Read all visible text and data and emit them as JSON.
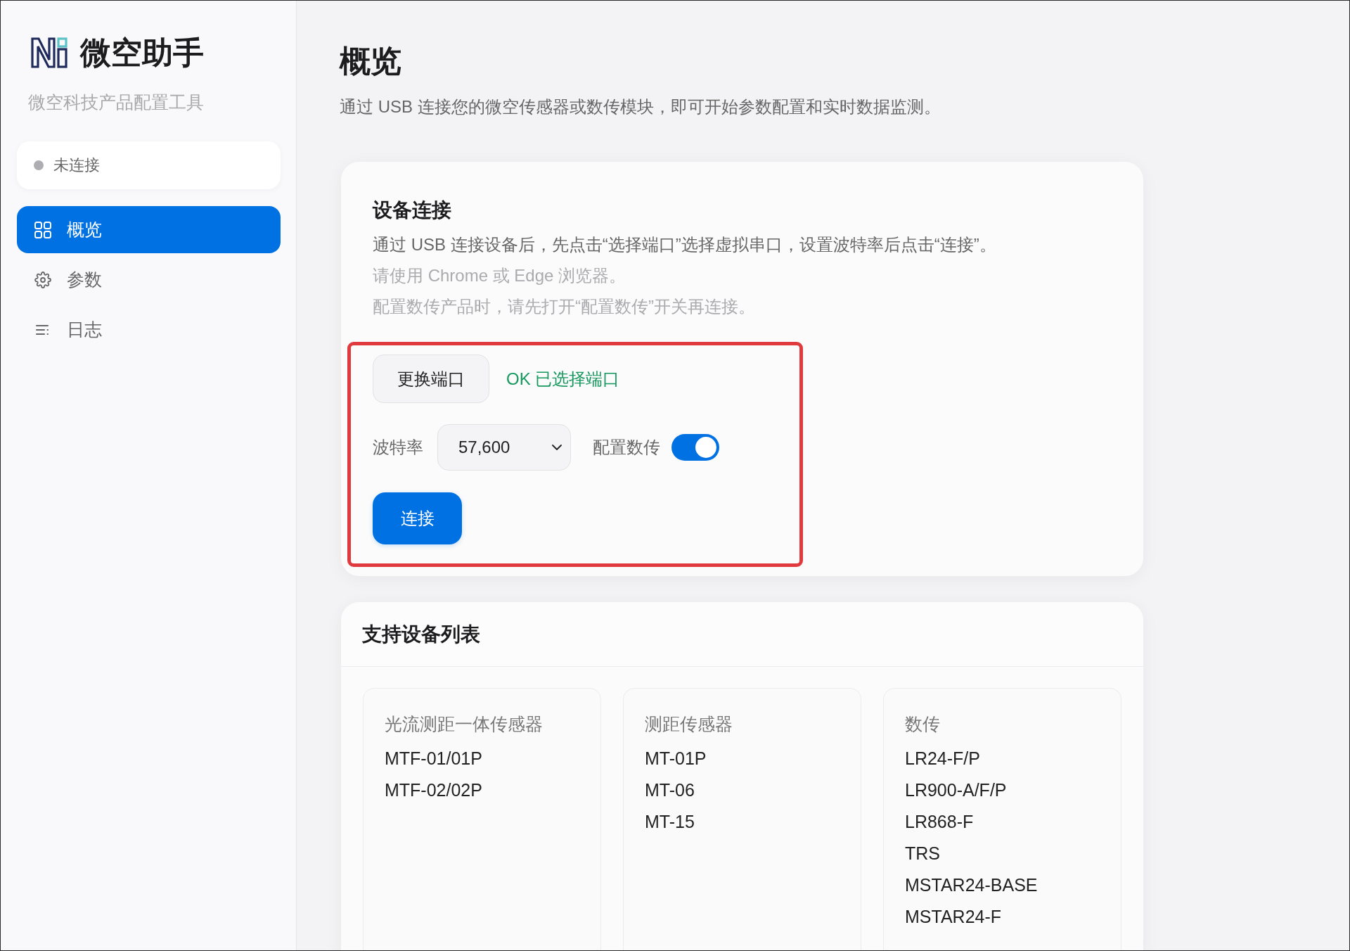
{
  "sidebar": {
    "app_name": "微空助手",
    "subtitle": "微空科技产品配置工具",
    "connection_status": {
      "label": "未连接",
      "connected": false
    },
    "nav_items": [
      {
        "label": "概览",
        "selected": true
      },
      {
        "label": "参数",
        "selected": false
      },
      {
        "label": "日志",
        "selected": false
      }
    ]
  },
  "page": {
    "title": "概览",
    "description": "通过 USB 连接您的微空传感器或数传模块，即可开始参数配置和实时数据监测。"
  },
  "connection_card": {
    "title": "设备连接",
    "instructions": [
      {
        "text": "通过 USB 连接设备后，先点击“选择端口”选择虚拟串口，设置波特率后点击“连接”。",
        "muted": false
      },
      {
        "text": "请使用 Chrome 或 Edge 浏览器。",
        "muted": true
      },
      {
        "text": "配置数传产品时，请先打开“配置数传”开关再连接。",
        "muted": true
      }
    ],
    "port_button": "更换端口",
    "port_status": "OK 已选择端口",
    "baud_rate": {
      "label": "波特率",
      "value": "57,600"
    },
    "radio_config": {
      "label": "配置数传",
      "on": true
    },
    "connect_button": "连接"
  },
  "device_list": {
    "title": "支持设备列表",
    "groups": [
      {
        "title": "光流测距一体传感器",
        "items": [
          "MTF-01/01P",
          "MTF-02/02P"
        ]
      },
      {
        "title": "测距传感器",
        "items": [
          "MT-01P",
          "MT-06",
          "MT-15"
        ]
      },
      {
        "title": "数传",
        "items": [
          "LR24-F/P",
          "LR900-A/F/P",
          "LR868-F",
          "TRS",
          "MSTAR24-BASE",
          "MSTAR24-F"
        ]
      }
    ]
  }
}
